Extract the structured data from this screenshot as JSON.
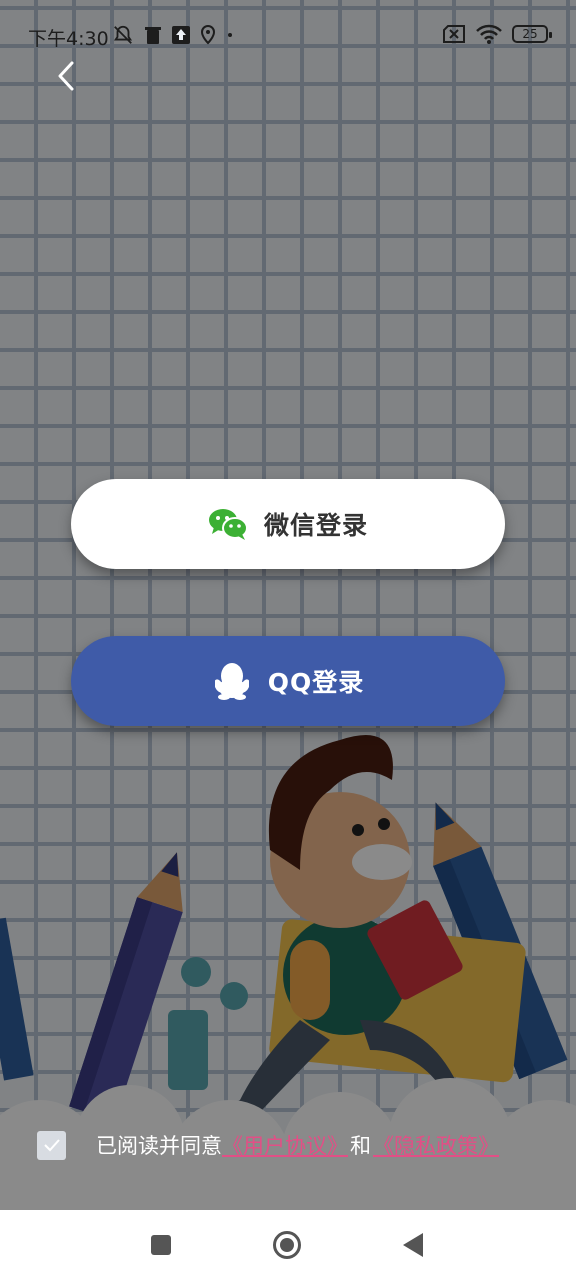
{
  "status_bar": {
    "time": "下午4:30",
    "battery": "25",
    "icons_left": [
      "bell-off-icon",
      "trash-icon",
      "upload-icon",
      "location-icon",
      "dot-icon"
    ],
    "icons_right": [
      "sim-off-icon",
      "wifi-icon",
      "battery-icon"
    ]
  },
  "header": {
    "back_icon": "chevron-left-icon"
  },
  "login": {
    "wechat_label": "微信登录",
    "wechat_icon": "wechat-icon",
    "wechat_color": "#3cb034",
    "qq_label": "QQ登录",
    "qq_icon": "qq-penguin-icon",
    "qq_button_color": "#3f5ba8"
  },
  "agreement": {
    "prefix": "已阅读并同意",
    "user_agreement": "《用户协议》",
    "and": "和",
    "privacy_policy": "《隐私政策》",
    "checked": true,
    "link_color": "#e24f86"
  },
  "nav": {
    "icons": [
      "square-recents-icon",
      "circle-home-icon",
      "triangle-back-icon"
    ]
  }
}
